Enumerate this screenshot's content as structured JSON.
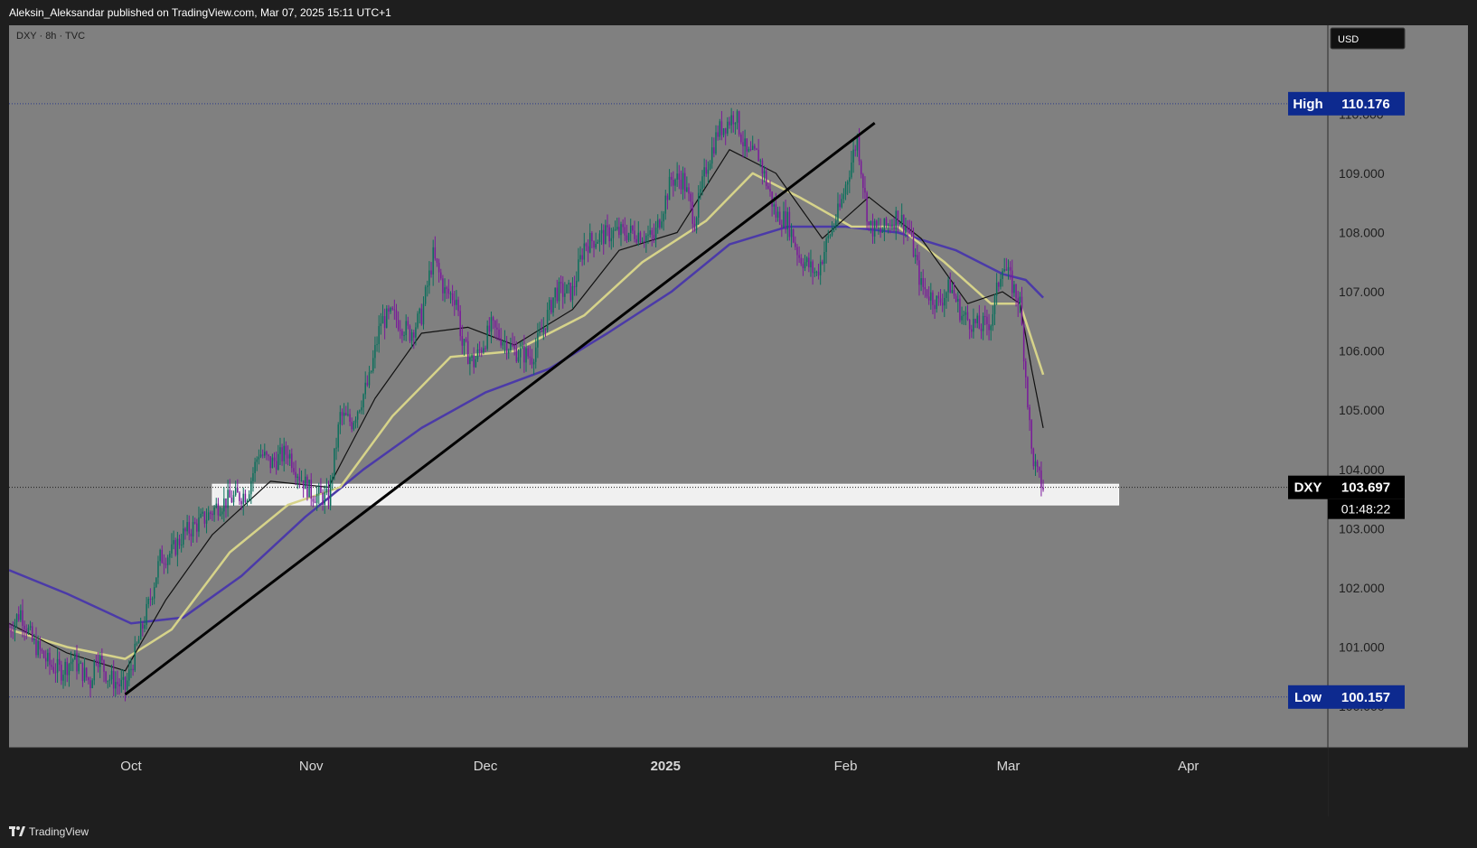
{
  "header": {
    "publisher_line": "Aleksin_Aleksandar published on TradingView.com, Mar 07, 2025 15:11 UTC+1"
  },
  "chart_header": {
    "symbol_line": "DXY · 8h · TVC",
    "currency_button": "USD"
  },
  "footer": {
    "brand": "TradingView"
  },
  "colors": {
    "background": "#808080",
    "frame": "#1e1e1e",
    "bull": "#0c6f5c",
    "bear": "#7a1a9a",
    "ma_slow": "#4b3aa8",
    "ma_mid": "#d6d38a",
    "ma_fast": "#111111",
    "trendline": "#000000",
    "zone": "#f0f0f0",
    "label_blue": "#0d2a8f"
  },
  "chart_data": {
    "type": "line",
    "title": "",
    "xlabel": "",
    "ylabel": "",
    "ylim": [
      99.3,
      111.5
    ],
    "x_ticks": [
      "Oct",
      "Nov",
      "Dec",
      "2025",
      "Feb",
      "Mar",
      "Apr"
    ],
    "y_ticks": [
      "110.000",
      "109.000",
      "108.000",
      "107.000",
      "106.000",
      "105.000",
      "104.000",
      "103.000",
      "102.000",
      "101.000",
      "100.000"
    ],
    "x_tick_dates": [
      "2024-10-01",
      "2024-11-01",
      "2024-12-01",
      "2025-01-01",
      "2025-02-01",
      "2025-03-01",
      "2025-04-01"
    ],
    "x_range": [
      "2024-09-10",
      "2025-04-25"
    ],
    "labels": {
      "high": {
        "name": "High",
        "value": "110.176"
      },
      "low": {
        "name": "Low",
        "value": "100.157"
      },
      "last": {
        "name": "DXY",
        "value": "103.697",
        "countdown": "01:48:22"
      }
    },
    "support_zone": {
      "from": 103.4,
      "to": 103.75,
      "start": "2024-10-15",
      "end": "2025-03-20"
    },
    "trendline": {
      "points": [
        [
          "2024-09-30",
          100.2
        ],
        [
          "2025-02-06",
          109.85
        ]
      ]
    },
    "price_path": [
      [
        "2024-09-10",
        101.3
      ],
      [
        "2024-09-12",
        101.6
      ],
      [
        "2024-09-14",
        101.1
      ],
      [
        "2024-09-17",
        100.7
      ],
      [
        "2024-09-19",
        100.6
      ],
      [
        "2024-09-21",
        100.8
      ],
      [
        "2024-09-24",
        100.4
      ],
      [
        "2024-09-25",
        100.9
      ],
      [
        "2024-09-27",
        100.5
      ],
      [
        "2024-09-30",
        100.3
      ],
      [
        "2024-10-02",
        101.0
      ],
      [
        "2024-10-04",
        101.7
      ],
      [
        "2024-10-06",
        102.5
      ],
      [
        "2024-10-08",
        102.6
      ],
      [
        "2024-10-10",
        102.9
      ],
      [
        "2024-10-14",
        103.2
      ],
      [
        "2024-10-16",
        103.4
      ],
      [
        "2024-10-18",
        103.5
      ],
      [
        "2024-10-21",
        103.6
      ],
      [
        "2024-10-23",
        104.3
      ],
      [
        "2024-10-25",
        104.1
      ],
      [
        "2024-10-28",
        104.3
      ],
      [
        "2024-10-30",
        103.9
      ],
      [
        "2024-11-01",
        103.6
      ],
      [
        "2024-11-04",
        103.5
      ],
      [
        "2024-11-06",
        104.9
      ],
      [
        "2024-11-08",
        104.8
      ],
      [
        "2024-11-11",
        105.5
      ],
      [
        "2024-11-13",
        106.5
      ],
      [
        "2024-11-15",
        106.6
      ],
      [
        "2024-11-18",
        106.3
      ],
      [
        "2024-11-20",
        106.6
      ],
      [
        "2024-11-22",
        107.6
      ],
      [
        "2024-11-24",
        107.0
      ],
      [
        "2024-11-26",
        106.9
      ],
      [
        "2024-11-27",
        106.1
      ],
      [
        "2024-11-29",
        105.8
      ],
      [
        "2024-12-02",
        106.4
      ],
      [
        "2024-12-04",
        106.2
      ],
      [
        "2024-12-06",
        106.0
      ],
      [
        "2024-12-09",
        105.9
      ],
      [
        "2024-12-11",
        106.4
      ],
      [
        "2024-12-13",
        107.0
      ],
      [
        "2024-12-16",
        107.0
      ],
      [
        "2024-12-18",
        107.8
      ],
      [
        "2024-12-20",
        107.9
      ],
      [
        "2024-12-23",
        108.0
      ],
      [
        "2024-12-27",
        108.0
      ],
      [
        "2024-12-30",
        107.9
      ],
      [
        "2025-01-02",
        108.9
      ],
      [
        "2025-01-04",
        108.9
      ],
      [
        "2025-01-06",
        108.2
      ],
      [
        "2025-01-08",
        109.1
      ],
      [
        "2025-01-10",
        109.7
      ],
      [
        "2025-01-13",
        110.0
      ],
      [
        "2025-01-15",
        109.3
      ],
      [
        "2025-01-17",
        109.3
      ],
      [
        "2025-01-20",
        108.3
      ],
      [
        "2025-01-22",
        108.2
      ],
      [
        "2025-01-24",
        107.6
      ],
      [
        "2025-01-27",
        107.3
      ],
      [
        "2025-01-29",
        107.9
      ],
      [
        "2025-01-31",
        108.4
      ],
      [
        "2025-02-03",
        109.6
      ],
      [
        "2025-02-05",
        108.1
      ],
      [
        "2025-02-07",
        108.0
      ],
      [
        "2025-02-10",
        108.3
      ],
      [
        "2025-02-12",
        108.0
      ],
      [
        "2025-02-14",
        107.1
      ],
      [
        "2025-02-17",
        106.8
      ],
      [
        "2025-02-19",
        107.1
      ],
      [
        "2025-02-21",
        106.6
      ],
      [
        "2025-02-24",
        106.4
      ],
      [
        "2025-02-26",
        106.5
      ],
      [
        "2025-02-28",
        107.5
      ],
      [
        "2025-03-03",
        106.8
      ],
      [
        "2025-03-04",
        105.6
      ],
      [
        "2025-03-05",
        104.3
      ],
      [
        "2025-03-06",
        103.9
      ],
      [
        "2025-03-07",
        103.7
      ]
    ],
    "series": [
      {
        "line": "fast",
        "points": [
          [
            "2024-09-10",
            101.4
          ],
          [
            "2024-09-20",
            100.9
          ],
          [
            "2024-09-30",
            100.6
          ],
          [
            "2024-10-07",
            101.8
          ],
          [
            "2024-10-15",
            102.9
          ],
          [
            "2024-10-25",
            103.8
          ],
          [
            "2024-11-04",
            103.7
          ],
          [
            "2024-11-12",
            105.2
          ],
          [
            "2024-11-20",
            106.3
          ],
          [
            "2024-11-28",
            106.4
          ],
          [
            "2024-12-06",
            106.1
          ],
          [
            "2024-12-16",
            106.7
          ],
          [
            "2024-12-24",
            107.7
          ],
          [
            "2025-01-03",
            108.0
          ],
          [
            "2025-01-12",
            109.4
          ],
          [
            "2025-01-20",
            109.0
          ],
          [
            "2025-01-28",
            107.9
          ],
          [
            "2025-02-05",
            108.6
          ],
          [
            "2025-02-14",
            107.9
          ],
          [
            "2025-02-22",
            106.8
          ],
          [
            "2025-02-28",
            107.0
          ],
          [
            "2025-03-03",
            106.8
          ],
          [
            "2025-03-05",
            105.7
          ],
          [
            "2025-03-07",
            104.7
          ]
        ]
      },
      {
        "line": "mid",
        "points": [
          [
            "2024-09-10",
            101.3
          ],
          [
            "2024-09-20",
            101.0
          ],
          [
            "2024-09-30",
            100.8
          ],
          [
            "2024-10-08",
            101.3
          ],
          [
            "2024-10-18",
            102.6
          ],
          [
            "2024-10-28",
            103.4
          ],
          [
            "2024-11-06",
            103.7
          ],
          [
            "2024-11-15",
            104.9
          ],
          [
            "2024-11-25",
            105.9
          ],
          [
            "2024-12-06",
            106.0
          ],
          [
            "2024-12-18",
            106.6
          ],
          [
            "2024-12-28",
            107.5
          ],
          [
            "2025-01-08",
            108.2
          ],
          [
            "2025-01-16",
            109.0
          ],
          [
            "2025-01-24",
            108.6
          ],
          [
            "2025-02-02",
            108.1
          ],
          [
            "2025-02-10",
            108.1
          ],
          [
            "2025-02-18",
            107.5
          ],
          [
            "2025-02-26",
            106.8
          ],
          [
            "2025-03-03",
            106.8
          ],
          [
            "2025-03-07",
            105.6
          ]
        ]
      },
      {
        "line": "slow",
        "points": [
          [
            "2024-09-10",
            102.3
          ],
          [
            "2024-09-20",
            101.9
          ],
          [
            "2024-10-01",
            101.4
          ],
          [
            "2024-10-10",
            101.5
          ],
          [
            "2024-10-20",
            102.2
          ],
          [
            "2024-10-31",
            103.2
          ],
          [
            "2024-11-10",
            104.0
          ],
          [
            "2024-11-20",
            104.7
          ],
          [
            "2024-12-01",
            105.3
          ],
          [
            "2024-12-12",
            105.7
          ],
          [
            "2024-12-22",
            106.3
          ],
          [
            "2025-01-02",
            107.0
          ],
          [
            "2025-01-12",
            107.8
          ],
          [
            "2025-01-22",
            108.1
          ],
          [
            "2025-02-01",
            108.1
          ],
          [
            "2025-02-10",
            108.0
          ],
          [
            "2025-02-20",
            107.7
          ],
          [
            "2025-02-28",
            107.3
          ],
          [
            "2025-03-04",
            107.2
          ],
          [
            "2025-03-07",
            106.9
          ]
        ]
      }
    ]
  }
}
